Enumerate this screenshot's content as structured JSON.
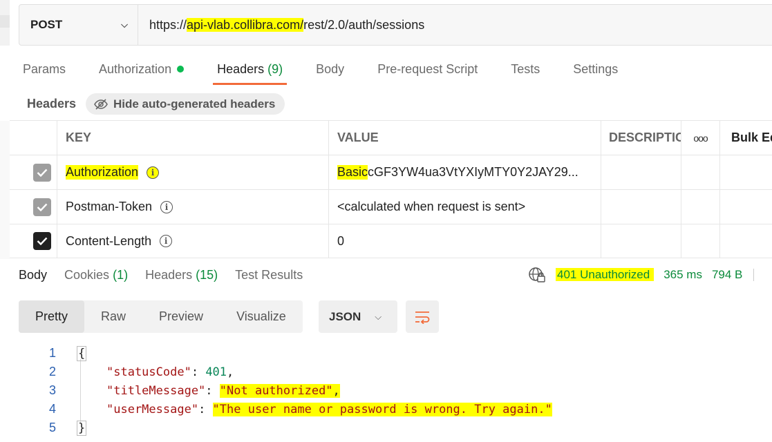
{
  "request": {
    "method": "POST",
    "url_prefix": "https://",
    "url_host": "api-vlab.collibra.com/",
    "url_path": "rest/2.0/auth/sessions"
  },
  "request_tabs": {
    "params": "Params",
    "authorization": "Authorization",
    "headers": "Headers",
    "headers_count": "(9)",
    "body": "Body",
    "prerequest": "Pre-request Script",
    "tests": "Tests",
    "settings": "Settings"
  },
  "headers_section": {
    "label": "Headers",
    "hide_button": "Hide auto-generated headers"
  },
  "headers_table": {
    "col_key": "KEY",
    "col_value": "VALUE",
    "col_description": "DESCRIPTIC",
    "more": "ooo",
    "bulk_edit": "Bulk Ed",
    "rows": [
      {
        "key": "Authorization",
        "value_prefix": "Basic",
        "value": " cGF3YW4ua3VtYXIyMTY0Y2JAY29...",
        "checked": true,
        "checkbox_style": "grey"
      },
      {
        "key": "Postman-Token",
        "value_prefix": "",
        "value": "<calculated when request is sent>",
        "checked": true,
        "checkbox_style": "grey"
      },
      {
        "key": "Content-Length",
        "value_prefix": "",
        "value": "0",
        "checked": true,
        "checkbox_style": "dark"
      }
    ]
  },
  "response_tabs": {
    "body": "Body",
    "cookies": "Cookies",
    "cookies_count": "(1)",
    "headers": "Headers",
    "headers_count": "(15)",
    "test_results": "Test Results"
  },
  "response_meta": {
    "status": "401 Unauthorized",
    "time": "365 ms",
    "size": "794 B"
  },
  "view_modes": {
    "pretty": "Pretty",
    "raw": "Raw",
    "preview": "Preview",
    "visualize": "Visualize",
    "format": "JSON"
  },
  "code": {
    "ln1": "1",
    "ln2": "2",
    "ln3": "3",
    "ln4": "4",
    "ln5": "5",
    "open_brace": "{",
    "close_brace": "}",
    "key1": "\"statusCode\"",
    "val1": "401",
    "key2": "\"titleMessage\"",
    "val2": "\"Not authorized\"",
    "key3": "\"userMessage\"",
    "val3": "\"The user name or password is wrong. Try again.\"",
    "colon": ": ",
    "comma": ","
  },
  "colors": {
    "accent": "#f26b3a",
    "success": "#0cbb52",
    "highlight": "#ffff00"
  }
}
